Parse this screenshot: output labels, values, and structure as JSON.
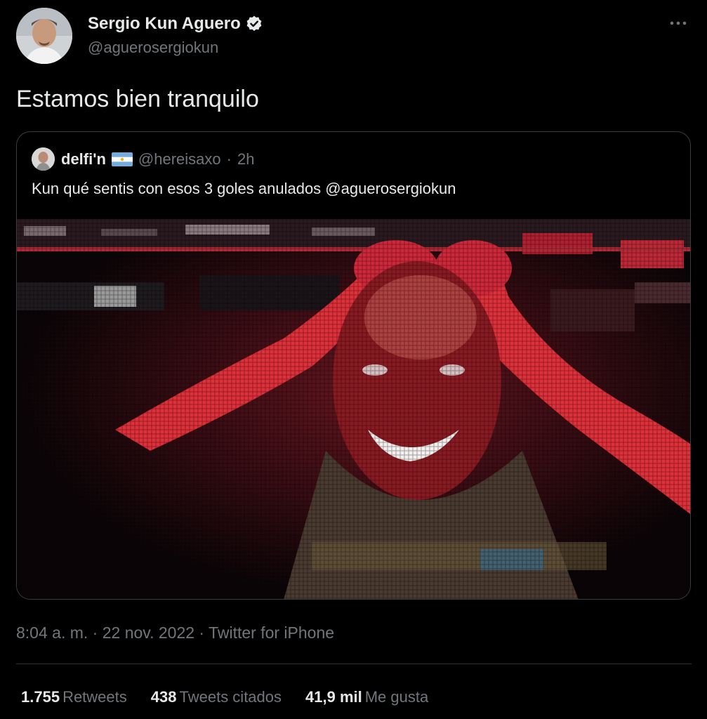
{
  "tweet": {
    "author_name": "Sergio Kun Aguero",
    "author_handle": "@aguerosergiokun",
    "text": "Estamos bien tranquilo",
    "time": "8:04 a. m.",
    "date": "22 nov. 2022",
    "source": "Twitter for iPhone",
    "separator": "·"
  },
  "quote": {
    "author_name": "delfi'n",
    "author_handle": "@hereisaxo",
    "separator": "·",
    "time": "2h",
    "text": "Kun qué sentis con esos 3 goles anulados @aguerosergiokun"
  },
  "stats": [
    {
      "count": "1.755",
      "label": "Retweets"
    },
    {
      "count": "438",
      "label": "Tweets citados"
    },
    {
      "count": "41,9 mil",
      "label": "Me gusta"
    }
  ],
  "icons": {
    "verified": "verified-badge-icon",
    "more": "more-options-icon",
    "flag": "argentina-flag-icon"
  },
  "colors": {
    "background": "#000000",
    "text": "#e7e9ea",
    "muted": "#71767b",
    "border": "#3a3d40",
    "image_accent": "#e0303a"
  }
}
